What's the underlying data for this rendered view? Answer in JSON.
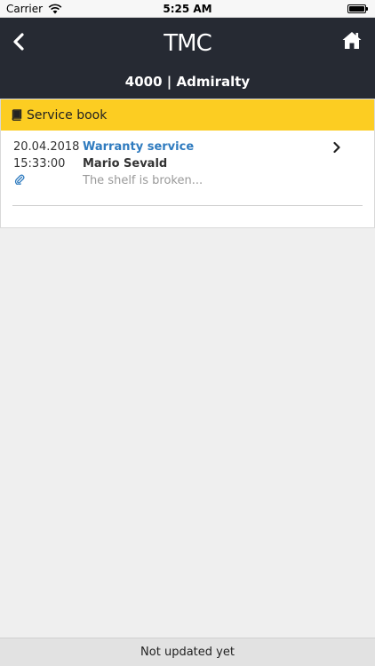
{
  "status_bar": {
    "carrier": "Carrier",
    "time": "5:25 AM",
    "icons": [
      "wifi-icon",
      "battery-icon"
    ]
  },
  "nav": {
    "logo": "TMC",
    "title": "4000 | Admiralty",
    "icons": [
      "chevron-left-icon",
      "home-icon"
    ]
  },
  "service_book": {
    "header": "Service book",
    "header_icon": "book-icon",
    "accent_color": "#fccd22",
    "entries": [
      {
        "date": "20.04.2018",
        "time": "15:33:00",
        "type": "Warranty service",
        "person": "Mario Sevald",
        "description": "The shelf is broken...",
        "attachment_icon": "paperclip-icon"
      }
    ]
  },
  "footer": {
    "text": "Not updated yet"
  },
  "colors": {
    "nav_bg": "#262a33",
    "link": "#2f7bbf",
    "page_bg": "#efefef"
  }
}
